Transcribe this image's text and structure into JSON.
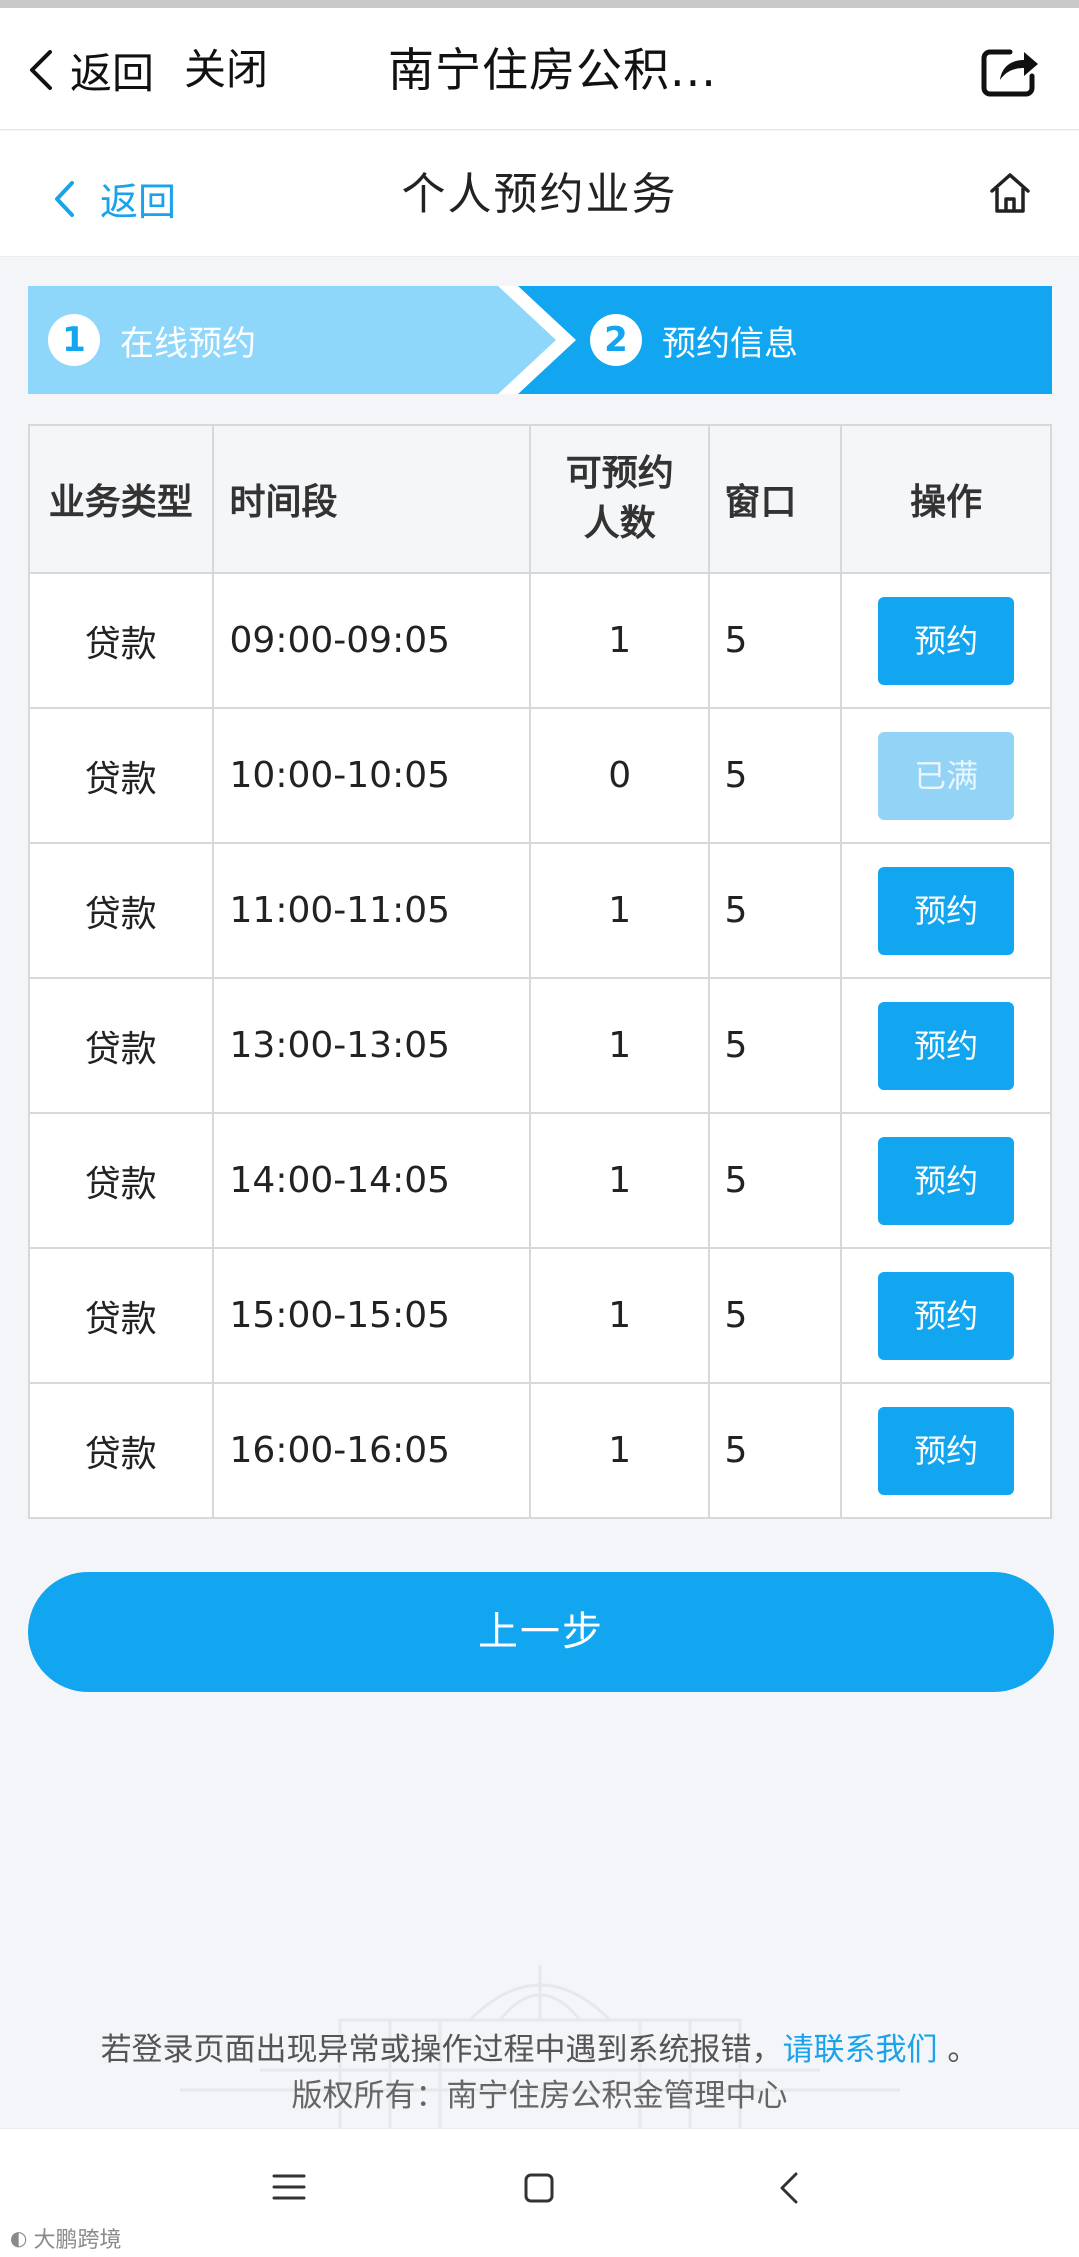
{
  "appbar": {
    "back_label": "返回",
    "close_label": "关闭",
    "title": "南宁住房公积..."
  },
  "subheader": {
    "back_label": "返回",
    "title": "个人预约业务"
  },
  "steps": [
    {
      "num": "1",
      "label": "在线预约"
    },
    {
      "num": "2",
      "label": "预约信息"
    }
  ],
  "table": {
    "headers": [
      "业务类型",
      "时间段",
      "可预约人数",
      "窗口",
      "操作"
    ],
    "header_capacity_line1": "可预约",
    "header_capacity_line2": "人数",
    "rows": [
      {
        "type": "贷款",
        "time": "09:00-09:05",
        "available": "1",
        "window": "5",
        "action": "预约"
      },
      {
        "type": "贷款",
        "time": "10:00-10:05",
        "available": "0",
        "window": "5",
        "action": "已满"
      },
      {
        "type": "贷款",
        "time": "11:00-11:05",
        "available": "1",
        "window": "5",
        "action": "预约"
      },
      {
        "type": "贷款",
        "time": "13:00-13:05",
        "available": "1",
        "window": "5",
        "action": "预约"
      },
      {
        "type": "贷款",
        "time": "14:00-14:05",
        "available": "1",
        "window": "5",
        "action": "预约"
      },
      {
        "type": "贷款",
        "time": "15:00-15:05",
        "available": "1",
        "window": "5",
        "action": "预约"
      },
      {
        "type": "贷款",
        "time": "16:00-16:05",
        "available": "1",
        "window": "5",
        "action": "预约"
      }
    ]
  },
  "prev_button_label": "上一步",
  "footer": {
    "notice_text": "若登录页面出现异常或操作过程中遇到系统报错，",
    "contact_link": "请联系我们",
    "notice_end": "。",
    "copyright": "版权所有：南宁住房公积金管理中心"
  },
  "watermark": "大鹏跨境",
  "colors": {
    "primary": "#12a5f0",
    "step_inactive": "#8ed7fa",
    "button_disabled": "#93d4f6",
    "link": "#1aa3ea"
  },
  "icons": [
    "chevron-left-icon",
    "share-icon",
    "home-icon",
    "menu-icon",
    "square-icon",
    "back-nav-icon"
  ]
}
